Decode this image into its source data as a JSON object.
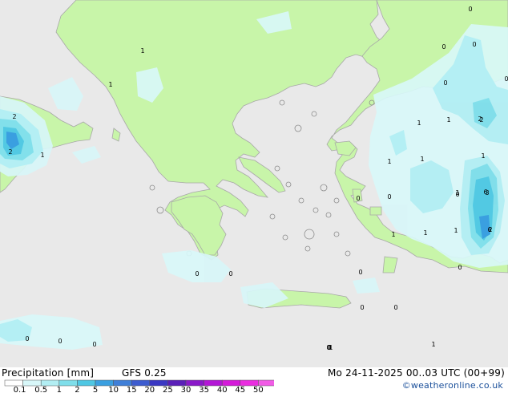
{
  "map": {
    "point_labels": [
      "0",
      "0",
      "0",
      "0",
      "0",
      "1",
      "1",
      "2",
      "1",
      "1",
      "1",
      "1",
      "2",
      "0",
      "1",
      "1",
      "0",
      "0",
      "0",
      "1",
      "1",
      "2",
      "3",
      "2",
      "0",
      "0",
      "0",
      "0",
      "0",
      "0",
      "0",
      "0",
      "0",
      "0",
      "0",
      "0",
      "1",
      "1",
      "1",
      "1",
      "2",
      "6",
      "6"
    ]
  },
  "footer": {
    "title": "Precipitation [mm]",
    "model": "GFS 0.25",
    "valid": "Mo 24-11-2025 00..03 UTC (00+99)",
    "credit": "©weatheronline.co.uk",
    "scale_labels": [
      "0.1",
      "0.5",
      "1",
      "2",
      "5",
      "10",
      "15",
      "20",
      "25",
      "30",
      "35",
      "40",
      "45",
      "50"
    ],
    "scale_colors": [
      "#ffffff",
      "#d8f7f9",
      "#b2eef3",
      "#7fdeea",
      "#4fc7e3",
      "#3a9fe0",
      "#3f7fd8",
      "#3d5ccf",
      "#3b38c3",
      "#5a1fb8",
      "#8a19c9",
      "#b317d6",
      "#d41ad9",
      "#ea2ee0",
      "#f15ce6"
    ]
  }
}
